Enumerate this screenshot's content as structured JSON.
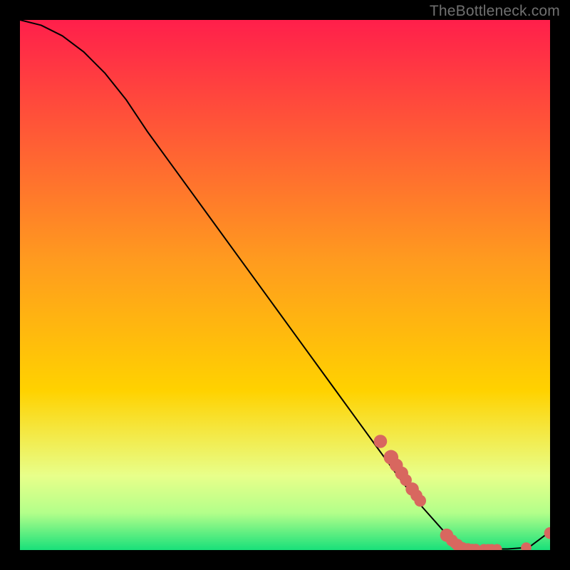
{
  "watermark": "TheBottleneck.com",
  "colors": {
    "background": "#000000",
    "gradient_top": "#ff1f4b",
    "gradient_mid": "#ffd200",
    "gradient_low": "#e8ff8a",
    "gradient_bottom": "#18e07a",
    "curve": "#000000",
    "marker": "#d8675f"
  },
  "chart_data": {
    "type": "line",
    "title": "",
    "xlabel": "",
    "ylabel": "",
    "xlim": [
      0,
      100
    ],
    "ylim": [
      0,
      100
    ],
    "description": "Bottleneck curve: value starts near 100, slight convex bend then near-linear descent to a minimum near x≈84, flat near zero until x≈96, then rises slightly by x=100.",
    "series": [
      {
        "name": "bottleneck-curve",
        "x": [
          0,
          4,
          8,
          12,
          16,
          20,
          24,
          28,
          32,
          36,
          40,
          44,
          48,
          52,
          56,
          60,
          64,
          68,
          72,
          76,
          80,
          84,
          88,
          92,
          96,
          100
        ],
        "y": [
          100,
          99,
          97,
          94,
          90,
          85,
          79,
          73.5,
          68,
          62.5,
          57,
          51.5,
          46,
          40.5,
          35,
          29.5,
          24,
          18.5,
          13,
          8,
          3.5,
          0.5,
          0.2,
          0.2,
          0.5,
          3.5
        ]
      }
    ],
    "markers": {
      "name": "data-points",
      "points": [
        {
          "x": 68,
          "y": 20.5,
          "r": 1.3
        },
        {
          "x": 70,
          "y": 17.5,
          "r": 1.5
        },
        {
          "x": 71,
          "y": 16,
          "r": 1.3
        },
        {
          "x": 72,
          "y": 14.5,
          "r": 1.3
        },
        {
          "x": 72.8,
          "y": 13.2,
          "r": 1.1
        },
        {
          "x": 74,
          "y": 11.5,
          "r": 1.3
        },
        {
          "x": 74.8,
          "y": 10.3,
          "r": 1.1
        },
        {
          "x": 75.5,
          "y": 9.3,
          "r": 1.1
        },
        {
          "x": 80.5,
          "y": 2.8,
          "r": 1.3
        },
        {
          "x": 81.5,
          "y": 1.8,
          "r": 1.1
        },
        {
          "x": 82.5,
          "y": 1.0,
          "r": 1.1
        },
        {
          "x": 82.0,
          "y": 1.3,
          "r": 0.9
        },
        {
          "x": 83.5,
          "y": 0.5,
          "r": 0.9
        },
        {
          "x": 84.5,
          "y": 0.3,
          "r": 0.9
        },
        {
          "x": 85.3,
          "y": 0.25,
          "r": 0.8
        },
        {
          "x": 86.0,
          "y": 0.25,
          "r": 0.8
        },
        {
          "x": 87.5,
          "y": 0.22,
          "r": 0.8
        },
        {
          "x": 88.3,
          "y": 0.22,
          "r": 0.8
        },
        {
          "x": 89.0,
          "y": 0.22,
          "r": 0.8
        },
        {
          "x": 90.0,
          "y": 0.22,
          "r": 0.8
        },
        {
          "x": 95.5,
          "y": 0.45,
          "r": 0.9
        },
        {
          "x": 100,
          "y": 3.2,
          "r": 1.1
        }
      ]
    }
  }
}
